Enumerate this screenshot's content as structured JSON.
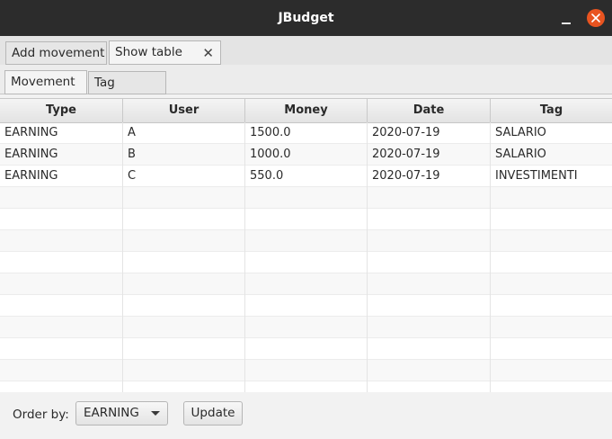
{
  "window": {
    "title": "JBudget"
  },
  "outer_tabs": [
    {
      "label": "Add movement"
    },
    {
      "label": "Show table",
      "close": "✕"
    }
  ],
  "inner_tabs": [
    {
      "label": "Movement"
    },
    {
      "label": "Tag"
    }
  ],
  "table": {
    "columns": [
      "Type",
      "User",
      "Money",
      "Date",
      "Tag"
    ],
    "rows": [
      [
        "EARNING",
        "A",
        "1500.0",
        "2020-07-19",
        "SALARIO"
      ],
      [
        "EARNING",
        "B",
        "1000.0",
        "2020-07-19",
        "SALARIO"
      ],
      [
        "EARNING",
        "C",
        "550.0",
        "2020-07-19",
        "INVESTIMENTI"
      ]
    ]
  },
  "footer": {
    "order_label": "Order by:",
    "order_value": "EARNING",
    "update_label": "Update"
  },
  "colors": {
    "close_button": "#e95420",
    "titlebar": "#2c2c2c"
  }
}
